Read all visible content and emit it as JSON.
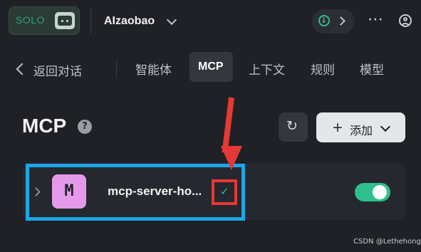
{
  "header": {
    "logo_text": "SOLO",
    "app_name": "AIzaobao",
    "more_icon": "ellipsis-icon",
    "account_icon": "user-circle-icon",
    "update_icon": "download-circle-icon"
  },
  "nav": {
    "back_label": "返回对话",
    "tabs": [
      {
        "label": "智能体",
        "active": false
      },
      {
        "label": "MCP",
        "active": true
      },
      {
        "label": "上下文",
        "active": false
      },
      {
        "label": "规则",
        "active": false
      },
      {
        "label": "模型",
        "active": false
      }
    ]
  },
  "mcp": {
    "title": "MCP",
    "help_glyph": "?",
    "add_label": "添加",
    "add_plus": "+",
    "refresh_glyph": "↻"
  },
  "servers": [
    {
      "avatar_letter": "M",
      "name": "mcp-server-ho...",
      "status_glyph": "✓",
      "enabled": true
    }
  ],
  "watermark": "CSDN @Lethehong",
  "colors": {
    "background": "#1f2126",
    "accent_green": "#2fbf8b",
    "annotation_blue": "#1aa6e8",
    "annotation_red": "#e53935",
    "avatar_pink": "#e59ae9"
  }
}
